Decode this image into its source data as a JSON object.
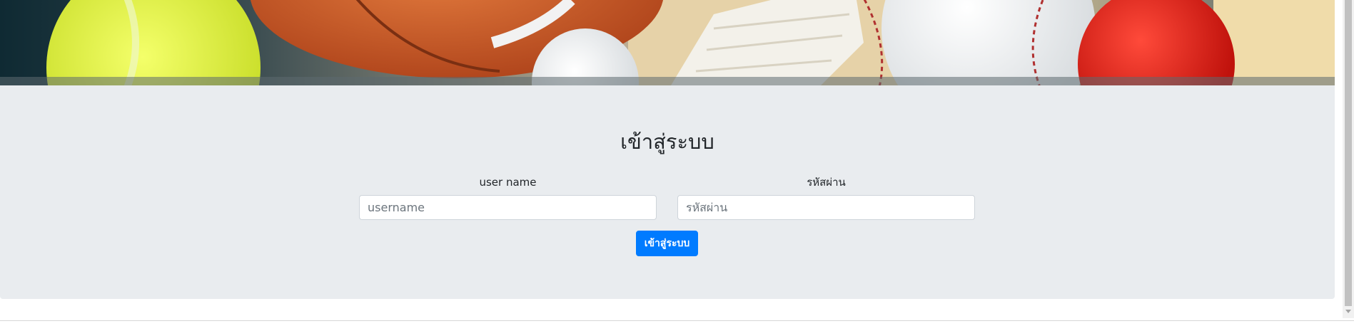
{
  "banner": {
    "description_icon": "sports-balls-image"
  },
  "login": {
    "title": "เข้าสู่ระบบ",
    "username_label": "user name",
    "username_placeholder": "username",
    "username_value": "",
    "password_label": "รหัสผ่าน",
    "password_placeholder": "รหัสผ่าน",
    "password_value": "",
    "submit_label": "เข้าสู่ระบบ"
  },
  "colors": {
    "panel_bg": "#e9ecef",
    "primary": "#007bff"
  }
}
